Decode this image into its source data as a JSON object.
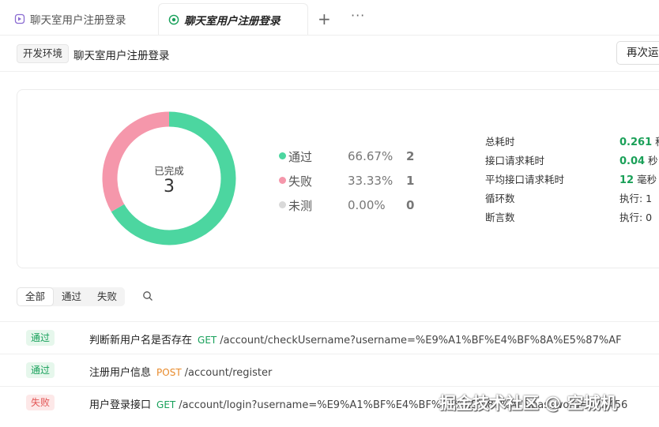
{
  "tabs": [
    {
      "label": "聊天室用户注册登录",
      "active": false
    },
    {
      "label": "聊天室用户注册登录",
      "active": true
    }
  ],
  "tab_actions": {
    "add": "+",
    "more": "···"
  },
  "header": {
    "env_badge": "开发环境",
    "title": "聊天室用户注册登录",
    "rerun_label": "再次运"
  },
  "summary": {
    "center_label": "已完成",
    "total": "3",
    "legend": [
      {
        "name": "通过",
        "pct": "66.67%",
        "count": "2",
        "color": "#4cd6a0",
        "fraction": 0.6667
      },
      {
        "name": "失败",
        "pct": "33.33%",
        "count": "1",
        "color": "#f597ab",
        "fraction": 0.3333
      },
      {
        "name": "未测",
        "pct": "0.00%",
        "count": "0",
        "color": "#d9d9d9",
        "fraction": 0
      }
    ],
    "metrics": [
      {
        "label": "总耗时",
        "value_bold": "0.261",
        "value_unit": " 秒"
      },
      {
        "label": "接口请求耗时",
        "value_bold": "0.04",
        "value_unit": " 秒"
      },
      {
        "label": "平均接口请求耗时",
        "value_bold": "12",
        "value_unit": " 毫秒"
      },
      {
        "label": "循环数",
        "value_bold": "",
        "value_unit": "执行: 1"
      },
      {
        "label": "断言数",
        "value_bold": "",
        "value_unit": "执行: 0"
      }
    ]
  },
  "filter": {
    "segments": [
      "全部",
      "通过",
      "失败"
    ],
    "active": "全部"
  },
  "results": [
    {
      "status": "通过",
      "name": "判断新用户名是否存在",
      "method": "GET",
      "path": "/account/checkUsername?username=%E9%A1%BF%E4%BF%8A%E5%87%AF"
    },
    {
      "status": "通过",
      "name": "注册用户信息",
      "method": "POST",
      "path": "/account/register"
    },
    {
      "status": "失败",
      "name": "用户登录接口",
      "method": "GET",
      "path": "/account/login?username=%E9%A1%BF%E4%BF%8A%E5%87%AF&password=123456"
    }
  ],
  "watermark": "掘金技术社区 @ 空城机",
  "colors": {
    "pass": "#17a05a",
    "fail": "#e25555",
    "post": "#e88a2a"
  }
}
